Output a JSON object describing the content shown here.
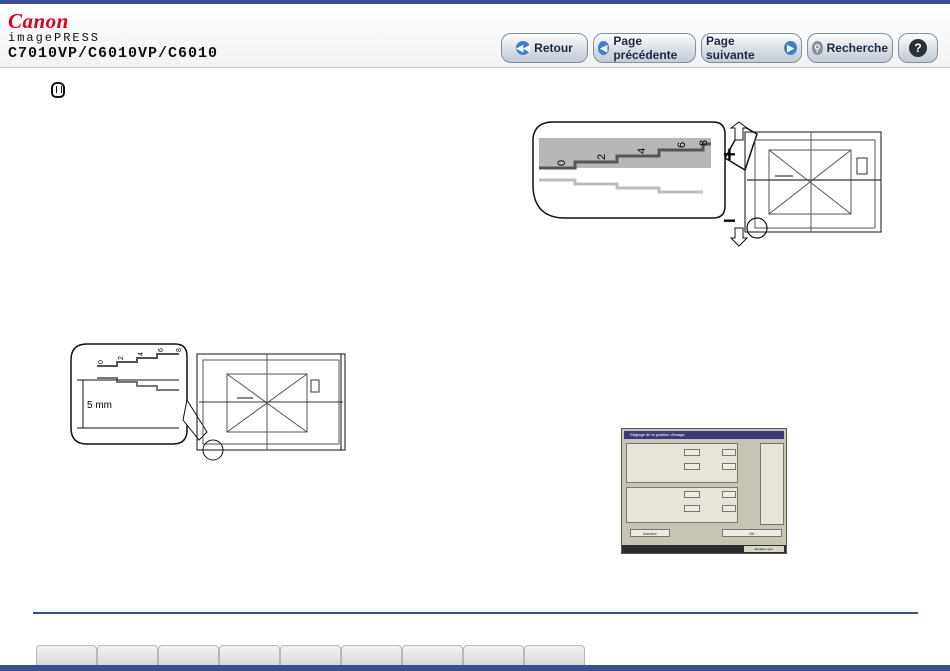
{
  "brand": {
    "logo": "Canon",
    "product": "imagePRESS",
    "model": "C7010VP/C6010VP/C6010"
  },
  "nav": {
    "back": "Retour",
    "previous": "Page précédente",
    "next": "Page suivante",
    "search": "Recherche",
    "help": "?"
  },
  "figure_top": {
    "scale_numbers": [
      "0",
      "2",
      "4",
      "6",
      "8"
    ],
    "plus_sign": "+",
    "minus_sign": "−"
  },
  "figure_left": {
    "scale_numbers": [
      "0",
      "2",
      "4",
      "6",
      "8"
    ],
    "measure_label": "5 mm"
  },
  "screen": {
    "title": "Réglage de la position d'image",
    "ok": "OK",
    "cancel": "Annuler",
    "status": "Moniteur syst."
  },
  "tabs": [
    "",
    "",
    "",
    "",
    "",
    "",
    "",
    "",
    ""
  ],
  "colors": {
    "accent": "#3a4f8f",
    "canon_red": "#d1001f",
    "button_text": "#1d2a44"
  }
}
